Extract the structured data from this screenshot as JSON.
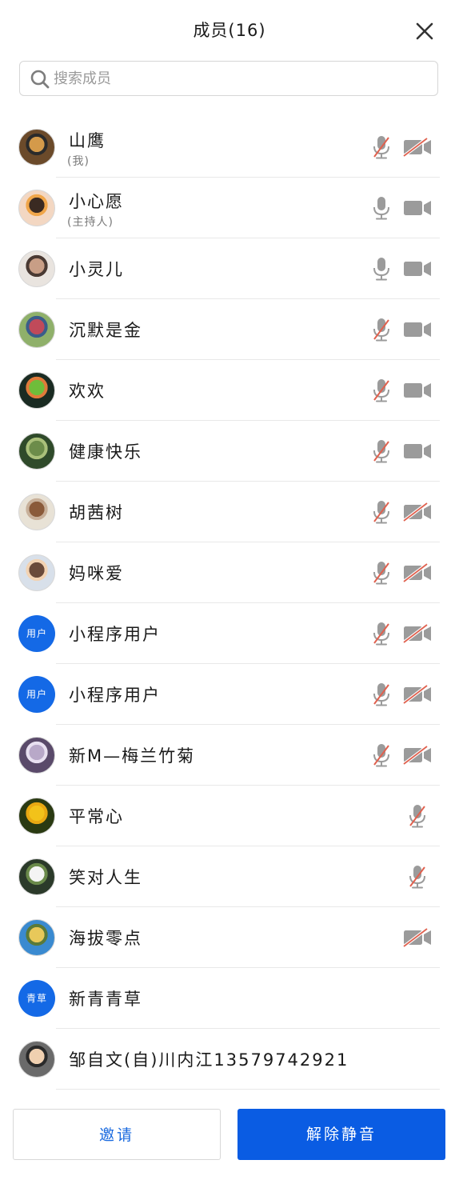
{
  "header": {
    "title": "成员(16)"
  },
  "search": {
    "placeholder": "搜索成员"
  },
  "members": [
    {
      "name": "山鹰",
      "sub": "(我)",
      "avatar": "photo",
      "mic": "muted",
      "cam": "off"
    },
    {
      "name": "小心愿",
      "sub": "(主持人)",
      "avatar": "photo",
      "mic": "on",
      "cam": "on"
    },
    {
      "name": "小灵儿",
      "avatar": "photo",
      "mic": "on",
      "cam": "on"
    },
    {
      "name": "沉默是金",
      "avatar": "photo",
      "mic": "muted",
      "cam": "on"
    },
    {
      "name": "欢欢",
      "avatar": "photo",
      "mic": "muted",
      "cam": "on"
    },
    {
      "name": "健康快乐",
      "avatar": "photo",
      "mic": "muted",
      "cam": "on"
    },
    {
      "name": "胡茜树",
      "avatar": "photo",
      "mic": "muted",
      "cam": "off"
    },
    {
      "name": "妈咪爱",
      "avatar": "photo",
      "mic": "muted",
      "cam": "off"
    },
    {
      "name": "小程序用户",
      "avatar": "text",
      "avatar_text": "用户",
      "mic": "muted",
      "cam": "off"
    },
    {
      "name": "小程序用户",
      "avatar": "text",
      "avatar_text": "用户",
      "mic": "muted",
      "cam": "off"
    },
    {
      "name": "新M—梅兰竹菊",
      "avatar": "photo",
      "mic": "muted",
      "cam": "off"
    },
    {
      "name": "平常心",
      "avatar": "photo",
      "mic": "muted",
      "cam": "none"
    },
    {
      "name": "笑对人生",
      "avatar": "photo",
      "mic": "muted",
      "cam": "none"
    },
    {
      "name": "海拔零点",
      "avatar": "photo",
      "mic": "none",
      "cam": "off"
    },
    {
      "name": "新青青草",
      "avatar": "text",
      "avatar_text": "青草",
      "mic": "none",
      "cam": "none"
    },
    {
      "name": "邹自文(自)川内江13579742921",
      "avatar": "photo",
      "mic": "none",
      "cam": "none"
    }
  ],
  "footer": {
    "invite_label": "邀请",
    "unmute_all_label": "解除静音"
  },
  "colors": {
    "primary": "#0a5ce3",
    "avatar_blue": "#1469e6",
    "icon_gray": "#9b9b9b",
    "muted_slash": "#e0614f",
    "text": "#1a1a1a",
    "subtext": "#7a7a7a"
  }
}
